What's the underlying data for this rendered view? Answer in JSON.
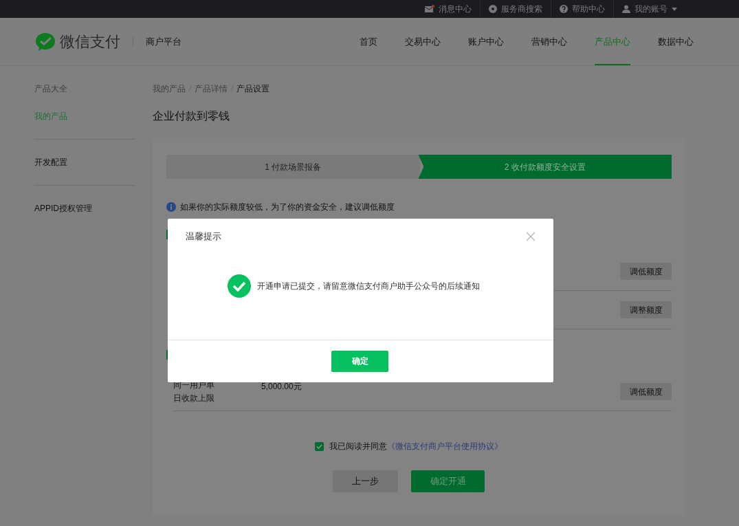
{
  "top_bar": {
    "links": [
      {
        "kind": "mail",
        "label": "消息中心",
        "unread": true
      },
      {
        "kind": "compass",
        "label": "服务商搜索"
      },
      {
        "kind": "help",
        "label": "帮助中心"
      },
      {
        "kind": "user",
        "label": "我的账号",
        "dropdown": true
      }
    ]
  },
  "header": {
    "logo_text": "微信支付",
    "platform": "商户平台",
    "nav": [
      {
        "label": "首页",
        "selected": false
      },
      {
        "label": "交易中心",
        "selected": false
      },
      {
        "label": "账户中心",
        "selected": false
      },
      {
        "label": "营销中心",
        "selected": false
      },
      {
        "label": "产品中心",
        "selected": true
      },
      {
        "label": "数据中心",
        "selected": false
      }
    ]
  },
  "sidebar": {
    "groups": [
      [
        {
          "label": "产品大全",
          "selected": false
        },
        {
          "label": "我的产品",
          "selected": true
        }
      ],
      [
        {
          "label": "开发配置",
          "selected": false
        }
      ],
      [
        {
          "label": "APPID授权管理",
          "selected": false
        }
      ]
    ]
  },
  "breadcrumb": [
    "我的产品",
    "产品详情",
    "产品设置"
  ],
  "page_title": "企业付款到零钱",
  "steps": [
    {
      "label": "1 付款场景报备",
      "selected": false
    },
    {
      "label": "2 收付款额度安全设置",
      "selected": true
    }
  ],
  "notice": "如果你的实际额度较低，为了你的资金安全，建议调低额度",
  "sections": [
    {
      "rows": [
        {
          "button": "调低额度"
        },
        {
          "button": "调整额度"
        }
      ]
    },
    {
      "rows": [
        {
          "label": "同一用户单日收款上限",
          "value": "5,000.00元",
          "button": "调低额度"
        }
      ]
    }
  ],
  "agreement": {
    "checked": true,
    "text": "我已阅读并同意",
    "link": "《微信支付商户平台使用协议》"
  },
  "actions": {
    "back": "上一步",
    "confirm": "确定开通"
  },
  "dialog": {
    "title": "温馨提示",
    "message": "开通申请已提交，请留意微信支付商户助手公众号的后续通知",
    "ok": "确定"
  }
}
